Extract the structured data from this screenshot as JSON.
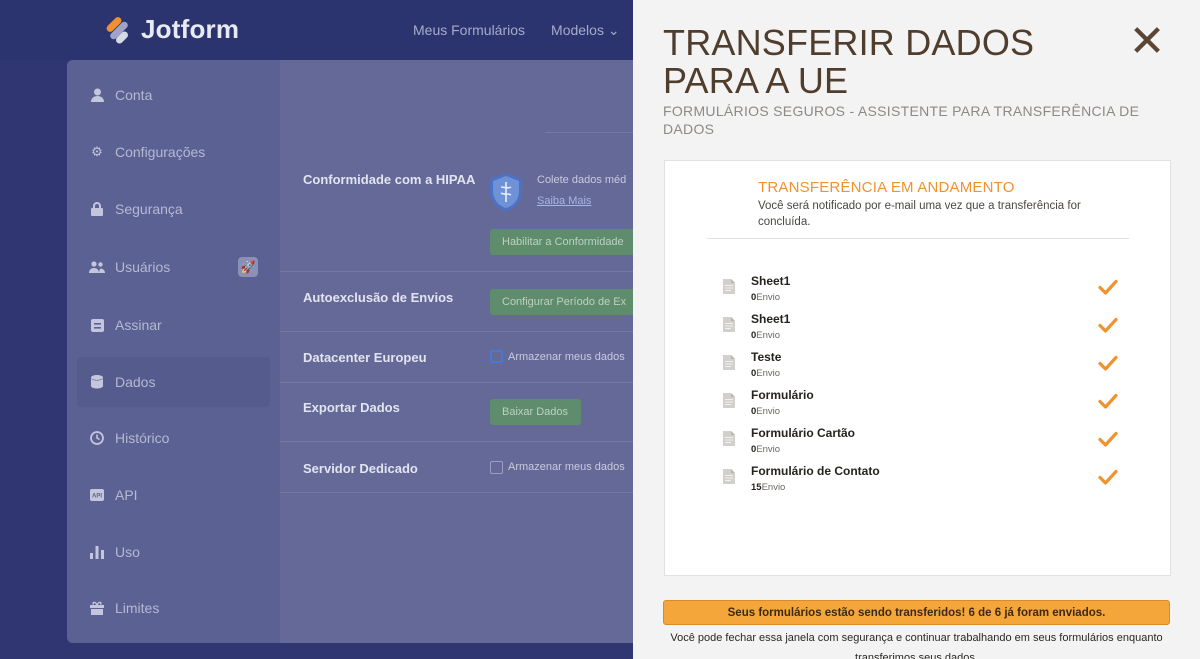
{
  "app": {
    "logo_text": "Jotform",
    "nav": [
      {
        "label": "Meus Formulários"
      },
      {
        "label": "Modelos ⌄"
      }
    ]
  },
  "sidebar": {
    "items": [
      {
        "label": "Conta",
        "icon": "user-icon"
      },
      {
        "label": "Configurações",
        "icon": "gear-icon"
      },
      {
        "label": "Segurança",
        "icon": "lock-icon"
      },
      {
        "label": "Usuários",
        "icon": "users-icon"
      },
      {
        "label": "Assinar",
        "icon": "signature-icon"
      },
      {
        "label": "Dados",
        "icon": "database-icon",
        "active": true
      },
      {
        "label": "Histórico",
        "icon": "history-icon"
      },
      {
        "label": "API",
        "icon": "api-icon"
      },
      {
        "label": "Uso",
        "icon": "bar-chart-icon"
      },
      {
        "label": "Limites",
        "icon": "gift-icon"
      }
    ]
  },
  "settings": {
    "hipaa_label": "Conformidade com a HIPAA",
    "hipaa_desc": "Colete dados méd",
    "hipaa_link": "Saiba Mais",
    "hipaa_button": "Habilitar a Conformidade",
    "autodelete_label": "Autoexclusão de Envios",
    "autodelete_button": "Configurar Período de Ex",
    "datacenter_label": "Datacenter Europeu",
    "datacenter_checkbox": "Armazenar meus dados",
    "export_label": "Exportar Dados",
    "export_button": "Baixar Dados",
    "server_label": "Servidor Dedicado",
    "server_checkbox": "Armazenar meus dados"
  },
  "modal": {
    "title": "TRANSFERIR DADOS PARA A UE",
    "subtitle": "FORMULÁRIOS SEGUROS - ASSISTENTE PARA TRANSFERÊNCIA DE DADOS",
    "progress_title": "TRANSFERÊNCIA EM ANDAMENTO",
    "progress_desc": "Você será notificado por e-mail uma vez que a transferência for concluída.",
    "forms": [
      {
        "name": "Sheet1",
        "count": "0",
        "unit": "Envio",
        "done": true
      },
      {
        "name": "Sheet1",
        "count": "0",
        "unit": "Envio",
        "done": true
      },
      {
        "name": "Teste",
        "count": "0",
        "unit": "Envio",
        "done": true
      },
      {
        "name": "Formulário",
        "count": "0",
        "unit": "Envio",
        "done": true
      },
      {
        "name": "Formulário Cartão",
        "count": "0",
        "unit": "Envio",
        "done": true
      },
      {
        "name": "Formulário de Contato",
        "count": "15",
        "unit": "Envio",
        "done": true
      }
    ],
    "banner": "Seus formulários estão sendo transferidos! 6 de 6 já foram enviados.",
    "footer": "Você pode fechar essa janela com segurança e continuar trabalhando em seus formulários enquanto transferimos seus dados.",
    "accent_color": "#f0922e"
  }
}
